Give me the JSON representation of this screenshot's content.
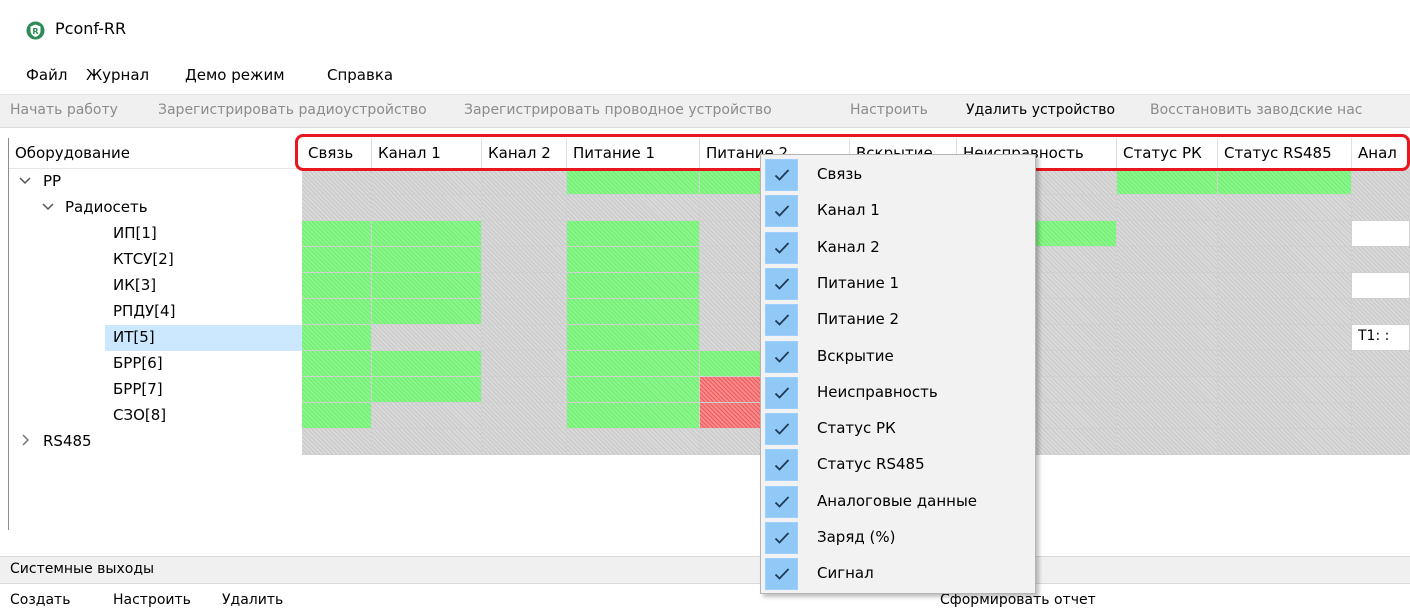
{
  "app": {
    "title": "Pconf-RR"
  },
  "menu": [
    "Файл",
    "Журнал",
    "Демо режим",
    "Справка"
  ],
  "toolbar": [
    {
      "label": "Начать работу",
      "enabled": false
    },
    {
      "label": "Зарегистрировать радиоустройство",
      "enabled": false
    },
    {
      "label": "Зарегистрировать проводное устройство",
      "enabled": false
    },
    {
      "label": "Настроить",
      "enabled": false
    },
    {
      "label": "Удалить устройство",
      "enabled": true
    },
    {
      "label": "Восстановить заводские нас",
      "enabled": false
    }
  ],
  "tree": {
    "header": "Оборудование",
    "items": [
      {
        "label": "РР",
        "expanded": true
      },
      {
        "label": "Радиосеть",
        "expanded": true
      },
      {
        "label": "ИП[1]"
      },
      {
        "label": "КТСУ[2]"
      },
      {
        "label": "ИК[3]"
      },
      {
        "label": "РПДУ[4]"
      },
      {
        "label": "ИТ[5]",
        "selected": true
      },
      {
        "label": "БРР[6]"
      },
      {
        "label": "БРР[7]"
      },
      {
        "label": "СЗО[8]"
      },
      {
        "label": "RS485",
        "expanded": false
      }
    ]
  },
  "grid": {
    "columns": [
      "Связь",
      "Канал 1",
      "Канал 2",
      "Питание 1",
      "Питание 2",
      "Вскрытие",
      "Неисправность",
      "Статус РК",
      "Статус RS485",
      "Анал"
    ],
    "rows": [
      [
        "gray",
        "gray",
        "gray",
        "green",
        "green",
        "gray",
        "gray",
        "green",
        "green",
        "gray"
      ],
      [
        "gray",
        "gray",
        "gray",
        "gray",
        "gray",
        "gray",
        "gray",
        "gray",
        "gray",
        "gray"
      ],
      [
        "green",
        "green",
        "gray",
        "green",
        "gray",
        "gray",
        "green",
        "gray",
        "gray",
        "white"
      ],
      [
        "green",
        "green",
        "gray",
        "green",
        "gray",
        "gray",
        "gray",
        "gray",
        "gray",
        "gray"
      ],
      [
        "green",
        "green",
        "gray",
        "green",
        "gray",
        "gray",
        "gray",
        "gray",
        "gray",
        "white"
      ],
      [
        "green",
        "green",
        "gray",
        "green",
        "gray",
        "gray",
        "gray",
        "gray",
        "gray",
        "gray"
      ],
      [
        "green",
        "gray",
        "gray",
        "green",
        "gray",
        "gray",
        "gray",
        "gray",
        "gray",
        "white"
      ],
      [
        "green",
        "green",
        "gray",
        "green",
        "green",
        "gray",
        "gray",
        "gray",
        "gray",
        "gray"
      ],
      [
        "green",
        "green",
        "gray",
        "green",
        "red",
        "gray",
        "gray",
        "gray",
        "gray",
        "gray"
      ],
      [
        "green",
        "gray",
        "gray",
        "green",
        "red",
        "gray",
        "gray",
        "gray",
        "gray",
        "gray"
      ],
      [
        "gray",
        "gray",
        "gray",
        "gray",
        "gray",
        "gray",
        "gray",
        "gray",
        "gray",
        "gray"
      ]
    ],
    "cell_text": {
      "row": 6,
      "col": 9,
      "text": "Т1: :"
    }
  },
  "context_menu": {
    "items": [
      {
        "label": "Связь",
        "checked": true
      },
      {
        "label": "Канал 1",
        "checked": true
      },
      {
        "label": "Канал 2",
        "checked": true
      },
      {
        "label": "Питание 1",
        "checked": true
      },
      {
        "label": "Питание 2",
        "checked": true
      },
      {
        "label": "Вскрытие",
        "checked": true
      },
      {
        "label": "Неисправность",
        "checked": true
      },
      {
        "label": "Статус РК",
        "checked": true
      },
      {
        "label": "Статус RS485",
        "checked": true
      },
      {
        "label": "Аналоговые данные",
        "checked": true
      },
      {
        "label": "Заряд (%)",
        "checked": true
      },
      {
        "label": "Сигнал",
        "checked": true
      }
    ]
  },
  "bottom": {
    "title": "Системные выходы",
    "actions": [
      "Создать",
      "Настроить",
      "Удалить"
    ],
    "report": "Сформировать отчет"
  },
  "colors": {
    "accent_red": "#e8161d",
    "status_green": "#7ef27e",
    "status_red": "#f37070",
    "status_gray": "#d0d0d0",
    "selection": "#cce8ff",
    "menu_check": "#90c8f6"
  }
}
